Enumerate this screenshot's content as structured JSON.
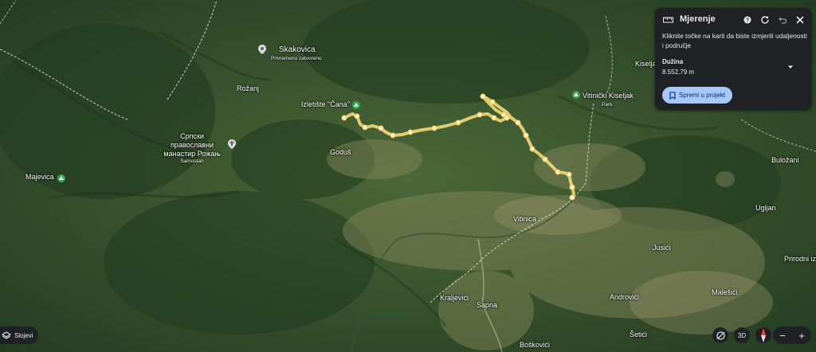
{
  "panel": {
    "title": "Mjerenje",
    "instruction": "Kliknite točke na karti da biste izmjerili udaljenosti i područje",
    "length_label": "Dužina",
    "length_value": "8.552,79 m",
    "save_label": "Spremi u projekt"
  },
  "places": [
    {
      "name": "Skakovica",
      "sub": "Privremeno zatvoreno"
    },
    {
      "name": "Rožanj"
    },
    {
      "name": "Izletište \"Čana\""
    },
    {
      "name": "Српски православни манастир Рожањ",
      "sub": "Samostan"
    },
    {
      "name": "Goduš"
    },
    {
      "name": "Majevica"
    },
    {
      "name": "Vitinica"
    },
    {
      "name": "Vitinički Kiseljak",
      "sub": "Park"
    },
    {
      "name": "Kiselja"
    },
    {
      "name": "Buložani"
    },
    {
      "name": "Ugljan"
    },
    {
      "name": "Jusići"
    },
    {
      "name": "Prirodni izv"
    },
    {
      "name": "Malešići"
    },
    {
      "name": "Androvići"
    },
    {
      "name": "Kraljevići"
    },
    {
      "name": "Sapna"
    },
    {
      "name": "Šetići"
    },
    {
      "name": "Boškovići"
    }
  ],
  "controls": {
    "layers_label": "Slojevi",
    "view_3d_label": "3D",
    "zoom_in": "+",
    "zoom_out": "−"
  },
  "icons": {
    "panel": "ruler-icon",
    "help": "help-icon",
    "reset": "refresh-icon",
    "undo": "undo-icon",
    "close": "close-icon",
    "expand": "chevron-down-icon",
    "save": "bookmark-icon"
  },
  "colors": {
    "path": "#f3d977",
    "panel_bg": "#202124",
    "button": "#a8c7fa",
    "compass_red": "#e8453c"
  }
}
